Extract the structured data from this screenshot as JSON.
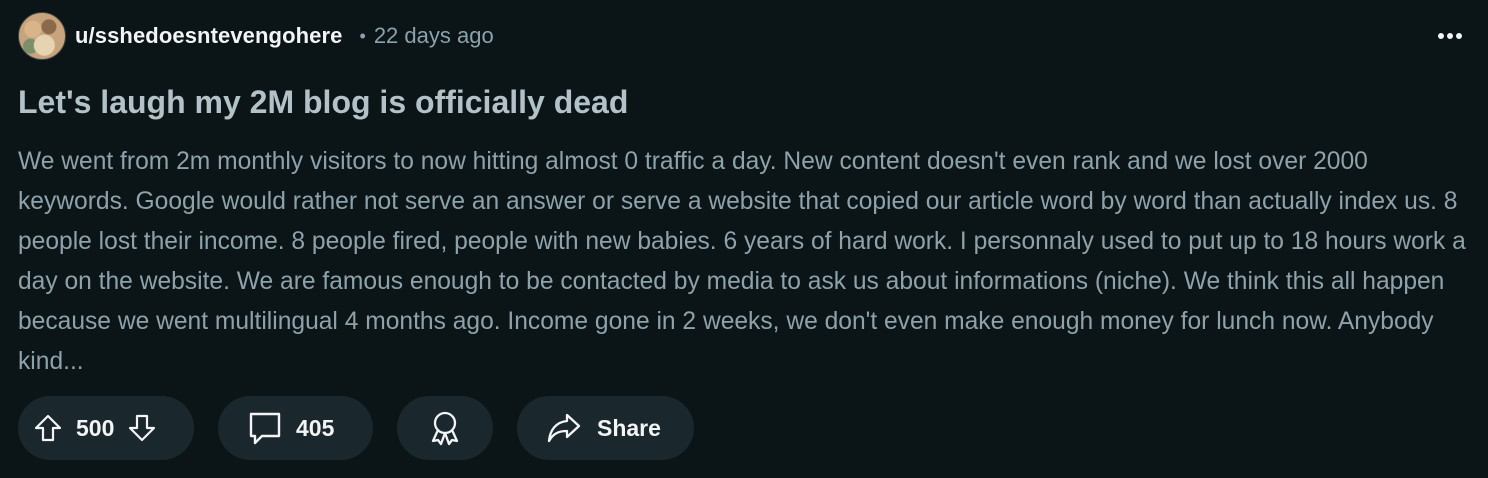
{
  "post": {
    "author": "u/sshedoesntevengohere",
    "separator": "•",
    "time_ago": "22 days ago",
    "title": "Let's laugh my 2M blog is officially dead",
    "body": "We went from 2m monthly visitors to now hitting almost 0 traffic a day. New content doesn't even rank and we lost over 2000 keywords. Google would rather not serve an answer or serve a website that copied our article word by word than actually index us. 8 people lost their income. 8 people fired, people with new babies. 6 years of hard work. I personnaly used to put up to 18 hours work a day on the website. We are famous enough to be contacted by media to ask us about informations (niche). We think this all happen because we went multilingual 4 months ago. Income gone in 2 weeks, we don't even make enough money for lunch now. Anybody kind..."
  },
  "actions": {
    "votes": "500",
    "comments": "405",
    "share_label": "Share"
  },
  "icons": {
    "avatar": "user-avatar",
    "more": "more-options-icon",
    "upvote": "arrow-up-icon",
    "downvote": "arrow-down-icon",
    "comment": "comment-bubble-icon",
    "award": "award-ribbon-icon",
    "share": "share-arrow-icon"
  },
  "colors": {
    "background": "#0b1416",
    "pill": "#1a282d",
    "title": "#b3c2c8",
    "body": "#8ea2ab",
    "meta": "#8ba2ad",
    "text_bright": "#f2f4f5"
  }
}
